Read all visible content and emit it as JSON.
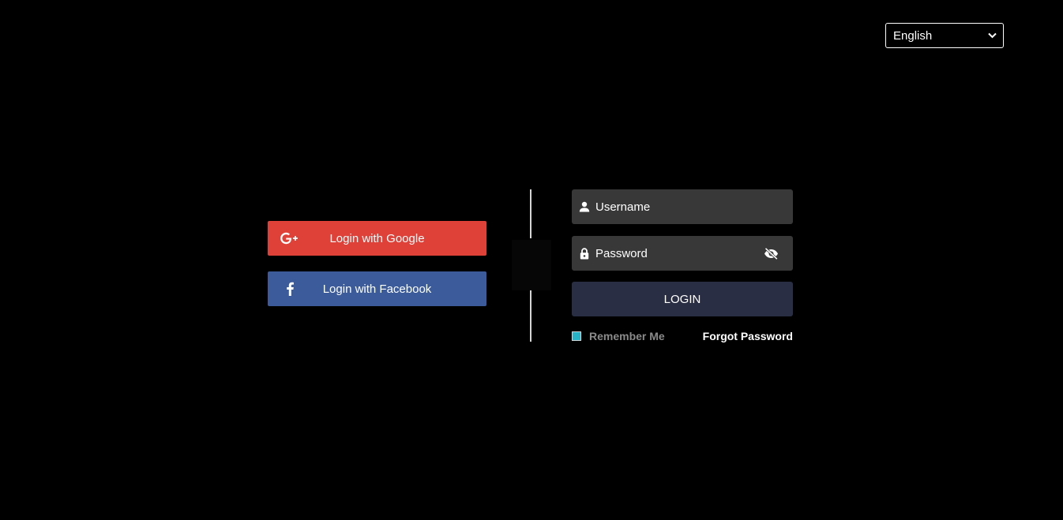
{
  "language": {
    "selected": "English"
  },
  "social": {
    "google_label": "Login with Google",
    "facebook_label": "Login with Facebook"
  },
  "form": {
    "username_placeholder": "Username",
    "password_placeholder": "Password",
    "login_label": "LOGIN",
    "remember_label": "Remember Me",
    "forgot_label": "Forgot Password"
  },
  "icons": {
    "google": "google-plus-icon",
    "facebook": "facebook-icon",
    "username": "user-icon",
    "password": "lock-icon",
    "visibility": "eye-off-icon",
    "dropdown": "chevron-down-icon"
  },
  "colors": {
    "background": "#000000",
    "google": "#df4037",
    "facebook": "#3b5b9a",
    "field": "#383838",
    "login_button": "#2a2e44",
    "checkbox": "#26b3c8"
  }
}
